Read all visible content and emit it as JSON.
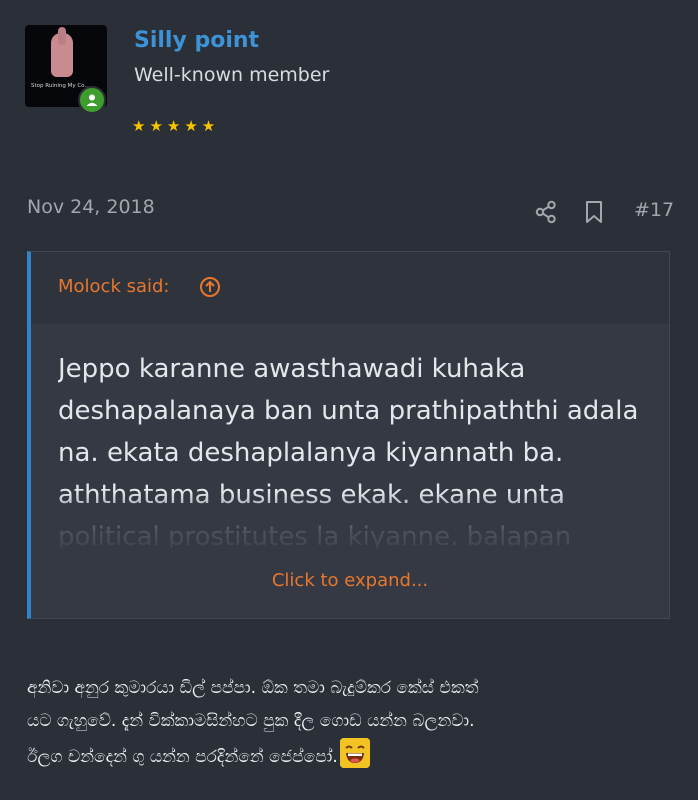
{
  "user": {
    "name": "Silly point",
    "title": "Well-known member",
    "stars": "★★★★★",
    "avatar_caption": "Stop Ruining My Co..."
  },
  "post": {
    "date": "Nov 24, 2018",
    "number": "#17",
    "quote": {
      "author": "Molock said:",
      "text": "Jeppo karanne awasthawadi kuhaka deshapalanaya ban unta prathipaththi adala na. ekata deshaplalanya kiyannath ba. aththatama business ekak. ekane unta political prostitutes la kiyanne. balapan",
      "expand_label": "Click to expand..."
    },
    "body": [
      "අනිවා අනුර කුමාරයා ඩිල් පප්පා. ඕක තමා බැදුම්කර කේස් එකත්",
      "යට ගැහුවේ. දැන් වික්කාමසින්හට පුක දීල ගොඩ යන්න බලනවා.",
      "ඊලග චන්දෙන් ගු යන්න පරදින්නේ ජෙප්පෝ."
    ]
  },
  "colors": {
    "accent": "#3d93d6",
    "quote_orange": "#e8772e",
    "star": "#f6c500",
    "online": "#3f9c2e"
  }
}
